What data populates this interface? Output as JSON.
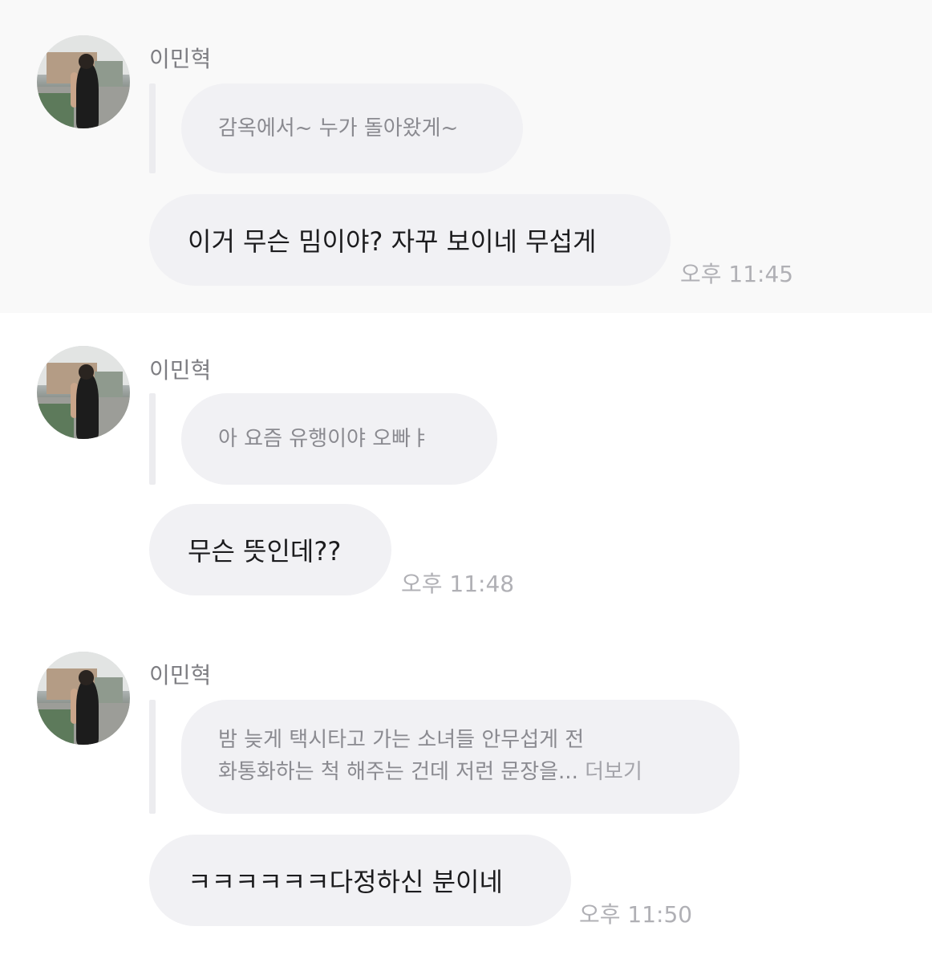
{
  "messages": [
    {
      "sender": "이민혁",
      "quoted": "감옥에서~ 누가 돌아왔게~",
      "text": "이거 무슨 밈이야? 자꾸 보이네 무섭게",
      "time": "오후 11:45"
    },
    {
      "sender": "이민혁",
      "quoted": "아 요즘 유행이야 오빠ㅑ",
      "text": "무슨 뜻인데??",
      "time": "오후 11:48"
    },
    {
      "sender": "이민혁",
      "quoted_line1": "밤 늦게 택시타고 가는 소녀들 안무섭게 전",
      "quoted_line2": "화통화하는 척 해주는 건데 저런 문장을...",
      "more_label": "더보기",
      "text": "ㅋㅋㅋㅋㅋㅋ다정하신 분이네",
      "time": "오후 11:50"
    }
  ],
  "colors": {
    "bubble": "#f1f1f4",
    "time": "#b0b0b5",
    "sender": "#7d7d82",
    "quote_text": "#8a8a90",
    "first_section_bg": "#f9f9f9"
  }
}
